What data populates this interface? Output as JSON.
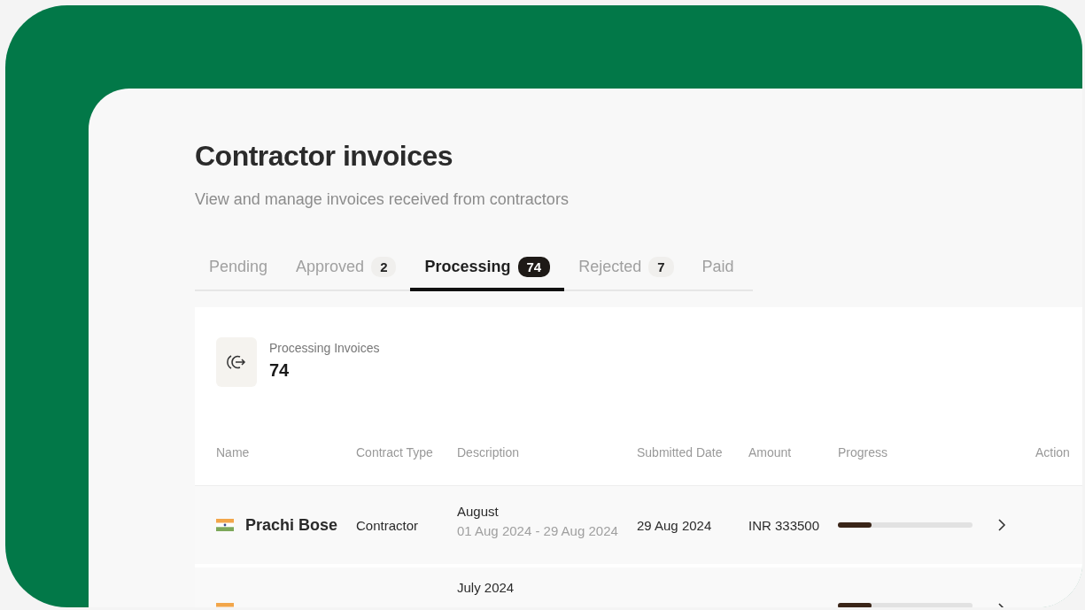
{
  "page": {
    "title": "Contractor invoices",
    "subtitle": "View and manage invoices received from contractors"
  },
  "tabs": [
    {
      "label": "Pending",
      "selected": false
    },
    {
      "label": "Approved",
      "count": "2",
      "selected": false
    },
    {
      "label": "Processing",
      "count": "74",
      "selected": true
    },
    {
      "label": "Rejected",
      "count": "7",
      "selected": false
    },
    {
      "label": "Paid",
      "selected": false
    }
  ],
  "summary": {
    "label": "Processing Invoices",
    "value": "74"
  },
  "table": {
    "columns": [
      "Name",
      "Contract Type",
      "Description",
      "Submitted Date",
      "Amount",
      "Progress",
      "Action"
    ],
    "rows": [
      {
        "name": "Prachi Bose",
        "contract_type": "Contractor",
        "description": "August",
        "period": "01 Aug 2024 - 29 Aug 2024",
        "submitted_date": "29 Aug 2024",
        "amount": "INR 333500",
        "level": 0.25
      },
      {
        "description": "July 2024",
        "level": 0.25
      }
    ]
  }
}
